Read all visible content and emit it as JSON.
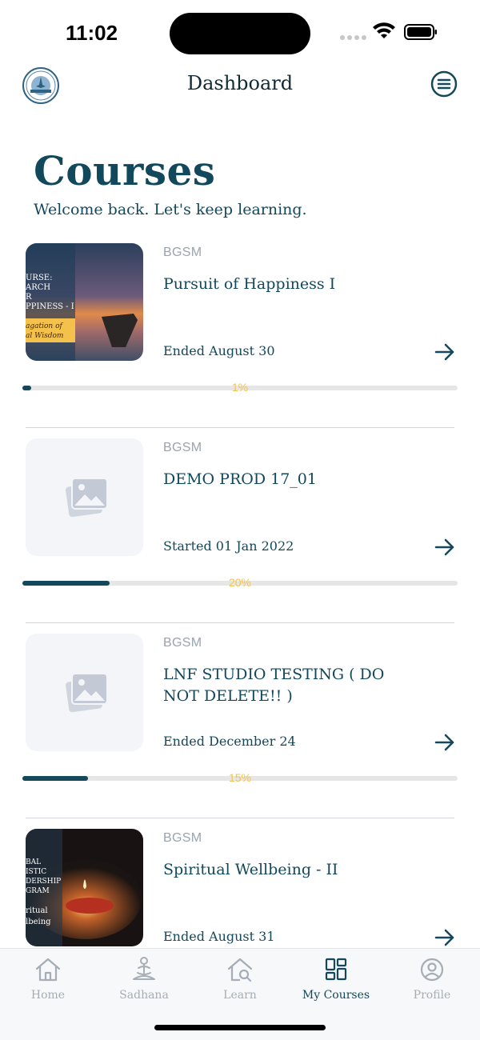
{
  "status_bar": {
    "time": "11:02",
    "icons": [
      "signal-icon",
      "wifi-icon",
      "battery-icon"
    ]
  },
  "header": {
    "title": "Dashboard",
    "logo_icon": "organization-logo",
    "menu_icon": "menu-icon"
  },
  "courses_section": {
    "heading": "Courses",
    "subtitle": "Welcome back. Let's keep learning."
  },
  "courses": [
    {
      "provider": "BGSM",
      "title": "Pursuit of Happiness I",
      "date": "Ended August 30",
      "progress": 1,
      "progress_label": "1%",
      "thumbnail": "course-image",
      "thumbnail_lines": [
        "URSE:",
        "ARCH",
        "R",
        "PPINESS - I"
      ],
      "thumbnail_tag": [
        "agation of",
        "al Wisdom"
      ]
    },
    {
      "provider": "BGSM",
      "title": "DEMO PROD 17_01",
      "date": "Started 01 Jan 2022",
      "progress": 20,
      "progress_label": "20%",
      "thumbnail": "image-placeholder-icon"
    },
    {
      "provider": "BGSM",
      "title": "LNF STUDIO TESTING ( DO NOT DELETE!! )",
      "date": "Ended December 24",
      "progress": 15,
      "progress_label": "15%",
      "thumbnail": "image-placeholder-icon"
    },
    {
      "provider": "BGSM",
      "title": "Spiritual Wellbeing - II",
      "date": "Ended August 31",
      "thumbnail": "course-image",
      "thumbnail_lines": [
        "BAL",
        "ISTIC",
        "DERSHIP",
        "GRAM"
      ],
      "thumbnail_tag": [
        "ritual",
        "lbeing"
      ]
    }
  ],
  "tab_bar": {
    "items": [
      {
        "label": "Home",
        "icon": "home-icon",
        "active": false
      },
      {
        "label": "Sadhana",
        "icon": "meditation-icon",
        "active": false
      },
      {
        "label": "Learn",
        "icon": "learn-icon",
        "active": false
      },
      {
        "label": "My Courses",
        "icon": "courses-icon",
        "active": true
      },
      {
        "label": "Profile",
        "icon": "profile-icon",
        "active": false
      }
    ]
  },
  "colors": {
    "primary": "#14485a",
    "progress_label": "#f2c34e",
    "muted": "#9aa3ad",
    "track": "#e6e6e6"
  }
}
